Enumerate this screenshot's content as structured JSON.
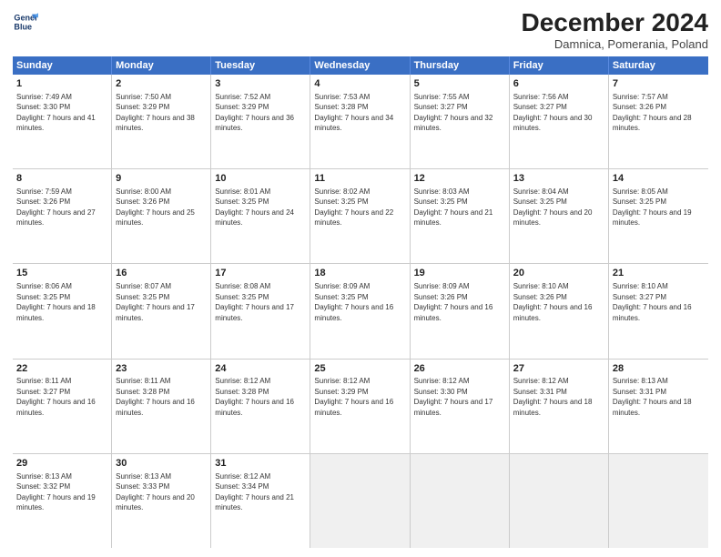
{
  "logo": {
    "line1": "General",
    "line2": "Blue"
  },
  "title": "December 2024",
  "subtitle": "Damnica, Pomerania, Poland",
  "days": [
    "Sunday",
    "Monday",
    "Tuesday",
    "Wednesday",
    "Thursday",
    "Friday",
    "Saturday"
  ],
  "weeks": [
    [
      {
        "day": "1",
        "rise": "Sunrise: 7:49 AM",
        "set": "Sunset: 3:30 PM",
        "daylight": "Daylight: 7 hours and 41 minutes."
      },
      {
        "day": "2",
        "rise": "Sunrise: 7:50 AM",
        "set": "Sunset: 3:29 PM",
        "daylight": "Daylight: 7 hours and 38 minutes."
      },
      {
        "day": "3",
        "rise": "Sunrise: 7:52 AM",
        "set": "Sunset: 3:29 PM",
        "daylight": "Daylight: 7 hours and 36 minutes."
      },
      {
        "day": "4",
        "rise": "Sunrise: 7:53 AM",
        "set": "Sunset: 3:28 PM",
        "daylight": "Daylight: 7 hours and 34 minutes."
      },
      {
        "day": "5",
        "rise": "Sunrise: 7:55 AM",
        "set": "Sunset: 3:27 PM",
        "daylight": "Daylight: 7 hours and 32 minutes."
      },
      {
        "day": "6",
        "rise": "Sunrise: 7:56 AM",
        "set": "Sunset: 3:27 PM",
        "daylight": "Daylight: 7 hours and 30 minutes."
      },
      {
        "day": "7",
        "rise": "Sunrise: 7:57 AM",
        "set": "Sunset: 3:26 PM",
        "daylight": "Daylight: 7 hours and 28 minutes."
      }
    ],
    [
      {
        "day": "8",
        "rise": "Sunrise: 7:59 AM",
        "set": "Sunset: 3:26 PM",
        "daylight": "Daylight: 7 hours and 27 minutes."
      },
      {
        "day": "9",
        "rise": "Sunrise: 8:00 AM",
        "set": "Sunset: 3:26 PM",
        "daylight": "Daylight: 7 hours and 25 minutes."
      },
      {
        "day": "10",
        "rise": "Sunrise: 8:01 AM",
        "set": "Sunset: 3:25 PM",
        "daylight": "Daylight: 7 hours and 24 minutes."
      },
      {
        "day": "11",
        "rise": "Sunrise: 8:02 AM",
        "set": "Sunset: 3:25 PM",
        "daylight": "Daylight: 7 hours and 22 minutes."
      },
      {
        "day": "12",
        "rise": "Sunrise: 8:03 AM",
        "set": "Sunset: 3:25 PM",
        "daylight": "Daylight: 7 hours and 21 minutes."
      },
      {
        "day": "13",
        "rise": "Sunrise: 8:04 AM",
        "set": "Sunset: 3:25 PM",
        "daylight": "Daylight: 7 hours and 20 minutes."
      },
      {
        "day": "14",
        "rise": "Sunrise: 8:05 AM",
        "set": "Sunset: 3:25 PM",
        "daylight": "Daylight: 7 hours and 19 minutes."
      }
    ],
    [
      {
        "day": "15",
        "rise": "Sunrise: 8:06 AM",
        "set": "Sunset: 3:25 PM",
        "daylight": "Daylight: 7 hours and 18 minutes."
      },
      {
        "day": "16",
        "rise": "Sunrise: 8:07 AM",
        "set": "Sunset: 3:25 PM",
        "daylight": "Daylight: 7 hours and 17 minutes."
      },
      {
        "day": "17",
        "rise": "Sunrise: 8:08 AM",
        "set": "Sunset: 3:25 PM",
        "daylight": "Daylight: 7 hours and 17 minutes."
      },
      {
        "day": "18",
        "rise": "Sunrise: 8:09 AM",
        "set": "Sunset: 3:25 PM",
        "daylight": "Daylight: 7 hours and 16 minutes."
      },
      {
        "day": "19",
        "rise": "Sunrise: 8:09 AM",
        "set": "Sunset: 3:26 PM",
        "daylight": "Daylight: 7 hours and 16 minutes."
      },
      {
        "day": "20",
        "rise": "Sunrise: 8:10 AM",
        "set": "Sunset: 3:26 PM",
        "daylight": "Daylight: 7 hours and 16 minutes."
      },
      {
        "day": "21",
        "rise": "Sunrise: 8:10 AM",
        "set": "Sunset: 3:27 PM",
        "daylight": "Daylight: 7 hours and 16 minutes."
      }
    ],
    [
      {
        "day": "22",
        "rise": "Sunrise: 8:11 AM",
        "set": "Sunset: 3:27 PM",
        "daylight": "Daylight: 7 hours and 16 minutes."
      },
      {
        "day": "23",
        "rise": "Sunrise: 8:11 AM",
        "set": "Sunset: 3:28 PM",
        "daylight": "Daylight: 7 hours and 16 minutes."
      },
      {
        "day": "24",
        "rise": "Sunrise: 8:12 AM",
        "set": "Sunset: 3:28 PM",
        "daylight": "Daylight: 7 hours and 16 minutes."
      },
      {
        "day": "25",
        "rise": "Sunrise: 8:12 AM",
        "set": "Sunset: 3:29 PM",
        "daylight": "Daylight: 7 hours and 16 minutes."
      },
      {
        "day": "26",
        "rise": "Sunrise: 8:12 AM",
        "set": "Sunset: 3:30 PM",
        "daylight": "Daylight: 7 hours and 17 minutes."
      },
      {
        "day": "27",
        "rise": "Sunrise: 8:12 AM",
        "set": "Sunset: 3:31 PM",
        "daylight": "Daylight: 7 hours and 18 minutes."
      },
      {
        "day": "28",
        "rise": "Sunrise: 8:13 AM",
        "set": "Sunset: 3:31 PM",
        "daylight": "Daylight: 7 hours and 18 minutes."
      }
    ],
    [
      {
        "day": "29",
        "rise": "Sunrise: 8:13 AM",
        "set": "Sunset: 3:32 PM",
        "daylight": "Daylight: 7 hours and 19 minutes."
      },
      {
        "day": "30",
        "rise": "Sunrise: 8:13 AM",
        "set": "Sunset: 3:33 PM",
        "daylight": "Daylight: 7 hours and 20 minutes."
      },
      {
        "day": "31",
        "rise": "Sunrise: 8:12 AM",
        "set": "Sunset: 3:34 PM",
        "daylight": "Daylight: 7 hours and 21 minutes."
      },
      null,
      null,
      null,
      null
    ]
  ]
}
